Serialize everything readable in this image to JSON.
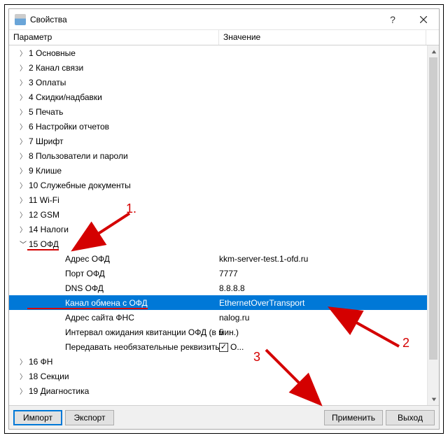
{
  "titlebar": {
    "title": "Свойства"
  },
  "columns": {
    "param": "Параметр",
    "value": "Значение"
  },
  "tree": {
    "items": [
      {
        "label": "1 Основные"
      },
      {
        "label": "2 Канал связи"
      },
      {
        "label": "3 Оплаты"
      },
      {
        "label": "4 Скидки/надбавки"
      },
      {
        "label": "5 Печать"
      },
      {
        "label": "6 Настройки отчетов"
      },
      {
        "label": "7 Шрифт"
      },
      {
        "label": "8 Пользователи и пароли"
      },
      {
        "label": "9 Клише"
      },
      {
        "label": "10 Служебные документы"
      },
      {
        "label": "11 Wi-Fi"
      },
      {
        "label": "12 GSM"
      },
      {
        "label": "14 Налоги"
      },
      {
        "label": "15 ОФД",
        "open": true
      },
      {
        "label": "16 ФН"
      },
      {
        "label": "18 Секции"
      },
      {
        "label": "19 Диагностика"
      }
    ],
    "ofd_children": [
      {
        "label": "Адрес ОФД",
        "value": "kkm-server-test.1-ofd.ru"
      },
      {
        "label": "Порт ОФД",
        "value": "7777"
      },
      {
        "label": "DNS ОФД",
        "value": "8.8.8.8"
      },
      {
        "label": "Канал обмена с ОФД",
        "value": "EthernetOverTransport",
        "selected": true
      },
      {
        "label": "Адрес сайта ФНС",
        "value": "nalog.ru"
      },
      {
        "label": "Интервал ожидания квитанции ОФД (в мин.)",
        "value": "5"
      },
      {
        "label": "Передавать необязательные реквизиты в О...",
        "checkbox": true,
        "checked": true
      }
    ]
  },
  "footer": {
    "import": "Импорт",
    "export": "Экспорт",
    "apply": "Применить",
    "exit": "Выход"
  },
  "annotations": {
    "n1": "1.",
    "n2": "2",
    "n3": "3"
  }
}
